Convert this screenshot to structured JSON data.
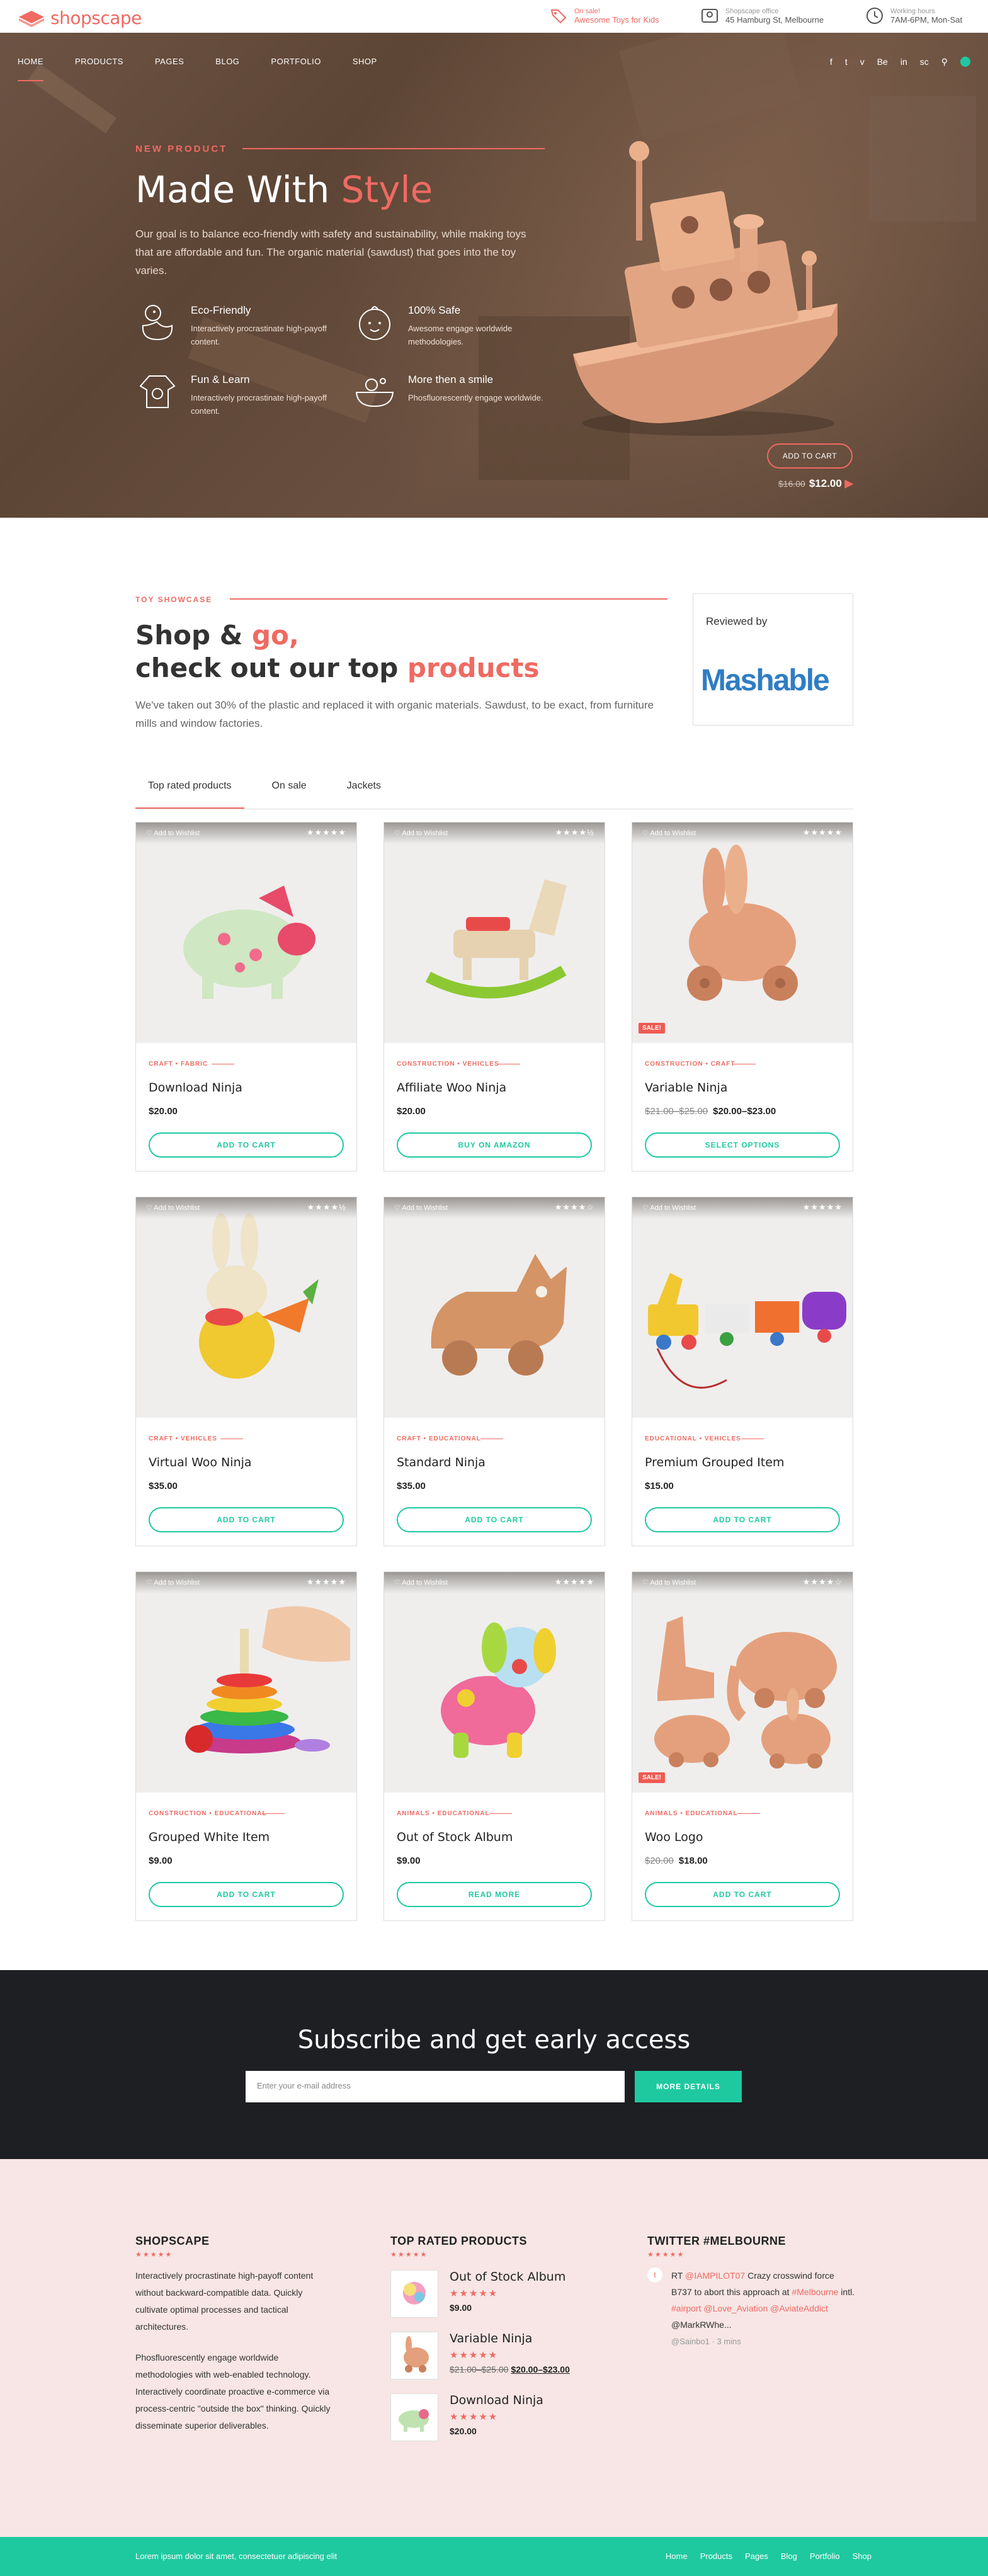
{
  "brand": {
    "name": "shopscape",
    "accent": "#ef6a62",
    "green": "#1fc9a0"
  },
  "topbar": {
    "sale": {
      "label": "On sale!",
      "text": "Awesome Toys for Kids",
      "icon": "tag-icon"
    },
    "office": {
      "label": "Shopscape office",
      "text": "45 Hamburg St, Melbourne",
      "icon": "map-icon"
    },
    "hours": {
      "label": "Working hours",
      "text": "7AM-6PM, Mon-Sat",
      "icon": "clock-icon"
    }
  },
  "nav": {
    "items": [
      "HOME",
      "PRODUCTS",
      "PAGES",
      "BLOG",
      "PORTFOLIO",
      "SHOP"
    ]
  },
  "social": [
    "f",
    "t",
    "v",
    "Be",
    "in",
    "sc",
    "so"
  ],
  "hero": {
    "tag": "NEW PRODUCT",
    "title_main": "Made With ",
    "title_accent": "Style",
    "desc": "Our goal is to balance eco-friendly with safety and sustainability, while making toys that are affordable and fun. The organic material (sawdust) that goes into the toy varies.",
    "features": [
      {
        "title": "Eco-Friendly",
        "text": "Interactively procrastinate high-payoff content.",
        "icon": "duck-icon"
      },
      {
        "title": "100% Safe",
        "text": "Awesome engage worldwide methodologies.",
        "icon": "baby-icon"
      },
      {
        "title": "Fun & Learn",
        "text": "Interactively procrastinate high-payoff content.",
        "icon": "onesie-icon"
      },
      {
        "title": "More then a smile",
        "text": "Phosfluorescently engage worldwide.",
        "icon": "bath-icon"
      }
    ],
    "cta": "ADD TO CART",
    "old_price": "$16.00",
    "price": "$12.00"
  },
  "showcase": {
    "tag": "TOY SHOWCASE",
    "title_l1_a": "Shop & ",
    "title_l1_b": "go,",
    "title_l2_a": "check out our top ",
    "title_l2_b": "products",
    "desc": "We've taken out 30% of the plastic and replaced it with organic materials. Sawdust, to be exact, from furniture mills and window factories.",
    "review_label": "Reviewed by",
    "review_logo": "Mashable"
  },
  "tabs": [
    "Top rated products",
    "On sale",
    "Jackets"
  ],
  "products": [
    {
      "cat": "CRAFT • FABRIC",
      "name": "Download Ninja",
      "old": "",
      "price": "$20.00",
      "btn": "ADD TO CART",
      "stars": "★★★★★",
      "sale": "",
      "toy": "pig"
    },
    {
      "cat": "CONSTRUCTION • VEHICLES",
      "name": "Affiliate Woo Ninja",
      "old": "",
      "price": "$20.00",
      "btn": "BUY ON AMAZON",
      "stars": "★★★★½",
      "sale": "",
      "toy": "horse"
    },
    {
      "cat": "CONSTRUCTION • CRAFT",
      "name": "Variable Ninja",
      "old": "$21.00–$25.00",
      "price": "$20.00–$23.00",
      "btn": "SELECT OPTIONS",
      "stars": "★★★★★",
      "sale": "SALE!",
      "toy": "rabbit"
    },
    {
      "cat": "CRAFT • VEHICLES",
      "name": "Virtual Woo Ninja",
      "old": "",
      "price": "$35.00",
      "btn": "ADD TO CART",
      "stars": "★★★★½",
      "sale": "",
      "toy": "bunny"
    },
    {
      "cat": "CRAFT • EDUCATIONAL",
      "name": "Standard Ninja",
      "old": "",
      "price": "$35.00",
      "btn": "ADD TO CART",
      "stars": "★★★★☆",
      "sale": "",
      "toy": "cat"
    },
    {
      "cat": "EDUCATIONAL • VEHICLES",
      "name": "Premium Grouped Item",
      "old": "",
      "price": "$15.00",
      "btn": "ADD TO CART",
      "stars": "★★★★★",
      "sale": "",
      "toy": "train"
    },
    {
      "cat": "CONSTRUCTION • EDUCATIONAL",
      "name": "Grouped White Item",
      "old": "",
      "price": "$9.00",
      "btn": "ADD TO CART",
      "stars": "★★★★★",
      "sale": "",
      "toy": "rings"
    },
    {
      "cat": "ANIMALS • EDUCATIONAL",
      "name": "Out of Stock Album",
      "old": "",
      "price": "$9.00",
      "btn": "READ MORE",
      "stars": "★★★★★",
      "sale": "",
      "toy": "dog"
    },
    {
      "cat": "ANIMALS • EDUCATIONAL",
      "name": "Woo Logo",
      "old": "$20.00",
      "price": "$18.00",
      "btn": "ADD TO CART",
      "stars": "★★★★☆",
      "sale": "SALE!",
      "toy": "animals"
    }
  ],
  "wishlist_label": "Add to Wishlist",
  "subscribe": {
    "title": "Subscribe and get early access",
    "placeholder": "Enter your e-mail address",
    "button": "MORE DETAILS"
  },
  "footer": {
    "col1_title": "SHOPSCAPE",
    "col1_p1": "Interactively procrastinate high-payoff content without backward-compatible data. Quickly cultivate optimal processes and tactical architectures.",
    "col1_p2": "Phosfluorescently engage worldwide methodologies with web-enabled technology. Interactively coordinate proactive e-commerce via process-centric \"outside the box\" thinking. Quickly disseminate superior deliverables.",
    "col2_title": "TOP RATED PRODUCTS",
    "top": [
      {
        "name": "Out of Stock Album",
        "old": "",
        "price": "$9.00"
      },
      {
        "name": "Variable Ninja",
        "old": "$21.00–$25.00",
        "price": "$20.00–$23.00"
      },
      {
        "name": "Download Ninja",
        "old": "",
        "price": "$20.00"
      }
    ],
    "col3_title": "TWITTER #MELBOURNE",
    "tweet_a": "RT ",
    "tweet_handle": "@IAMPILOT07",
    "tweet_b": " Crazy crosswind force B737 to abort this approach at ",
    "tweet_tag": "#Melbourne",
    "tweet_c": " intl. ",
    "tweet_tag2": "#airport",
    "tweet_handles": "@Love_Aviation @AviateAddict",
    "tweet_d": "@MarkRWhe...",
    "tweet_meta": "@Sainbo1 · 3 mins"
  },
  "bottom": {
    "text": "Lorem ipsum dolor sit amet, consectetuer adipiscing elit",
    "links": [
      "Home",
      "Products",
      "Pages",
      "Blog",
      "Portfolio",
      "Shop"
    ]
  }
}
